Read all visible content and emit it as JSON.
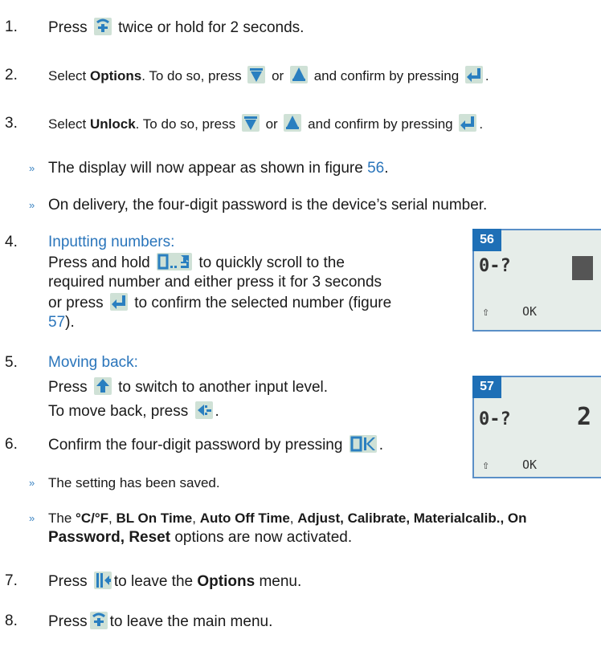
{
  "steps": [
    {
      "n": "1.",
      "a": "Press",
      "b": "twice or hold for 2 seconds."
    },
    {
      "n": "2.",
      "a": "Select",
      "bold": "Options",
      "b": ". To do so, press",
      "c": "or",
      "d": "and confirm by pressing",
      "e": "."
    },
    {
      "n": "3.",
      "a": "Select",
      "bold": "Unlock",
      "b": ". To do so, press",
      "c": "or",
      "d": "and confirm by pressing",
      "e": "."
    }
  ],
  "bullet_glyph": "»",
  "bullets_a": [
    {
      "t1": "The display will now appear as shown in figure ",
      "ref": "56",
      "t2": "."
    },
    {
      "t1": "On delivery, the four-digit password is the device’s serial number."
    }
  ],
  "step4": {
    "n": "4.",
    "heading": "Inputting numbers:",
    "l1a": "Press and hold",
    "l1b": "to quickly scroll to the",
    "l2": "required number and either press it for 3 seconds",
    "l3a": "or press",
    "l3b": "to confirm the selected number (figure",
    "ref": "57",
    "l4b": ")."
  },
  "step5": {
    "n": "5.",
    "heading": "Moving back:",
    "l1a": "Press",
    "l1b": "to switch to another input level.",
    "l2a": "To move back, press",
    "l2b": "."
  },
  "step6": {
    "n": "6.",
    "a": "Confirm the four-digit password by pressing",
    "b": "."
  },
  "bullets_b": {
    "saved": "The setting has been saved.",
    "pre": "The ",
    "opt1": "°C/°F",
    "sep1": ", ",
    "opt2": "BL On Time",
    "sep2": ", ",
    "opt3": "Auto Off Time",
    "sep3": ", ",
    "opt4": "Adjust, Calibrate, Materialcalib., On",
    "l2bold": "Password, Reset",
    "l2rest": " options are now activated."
  },
  "step7": {
    "n": "7.",
    "a": "Press",
    "b": "to leave the ",
    "bold": "Options",
    "c": " menu."
  },
  "step8": {
    "n": "8.",
    "a": "Press",
    "b": "to leave the main menu."
  },
  "figures": [
    {
      "num": "56",
      "key": "0-?",
      "softkey_left": "⇧",
      "softkey_ok": "OK"
    },
    {
      "num": "57",
      "key": "0-?",
      "digit": "2",
      "softkey_left": "⇧",
      "softkey_ok": "OK"
    }
  ],
  "icons": {
    "menu": "menu-icon",
    "down": "arrow-down-icon",
    "up": "arrow-up-icon",
    "enter": "enter-icon",
    "digits": "digits-0-9-icon",
    "shift": "shift-icon",
    "backspace": "backspace-icon",
    "ok": "ok-icon",
    "exit": "exit-menu-icon"
  }
}
